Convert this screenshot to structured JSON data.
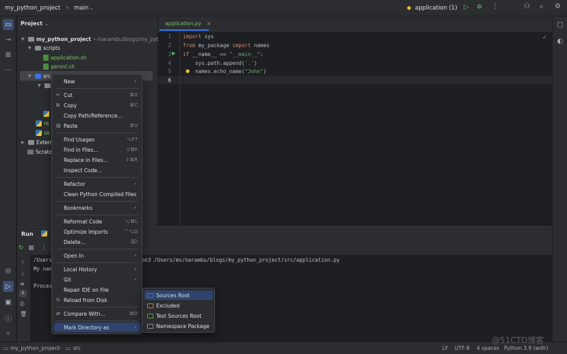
{
  "titlebar": {
    "project": "my_python_project",
    "branch": "main",
    "run_config": "application (1)"
  },
  "project_panel": {
    "title": "Project",
    "tree": [
      {
        "label": "my_python_project",
        "path": "~/narambu/blogs/my_python_"
      },
      {
        "label": "scripts"
      },
      {
        "label": "application.sh"
      },
      {
        "label": "genssl.sh"
      },
      {
        "label": "src"
      },
      {
        "label": "re"
      },
      {
        "label": "se"
      },
      {
        "label": "Extern"
      },
      {
        "label": "Scrato"
      }
    ]
  },
  "editor": {
    "tab": "application.py",
    "line_numbers": [
      "1",
      "2",
      "3",
      "4",
      "5",
      "6"
    ],
    "lines": [
      {
        "k1": "import",
        "rest": " sys"
      },
      {
        "k1": "from",
        "mid": " my_package ",
        "k2": "import",
        "rest": " names"
      },
      {
        "k1": "if",
        "rest": " __name__ == ",
        "s": "\"__main__\"",
        "tail": ":"
      },
      {
        "rest": "    sys.path.append(",
        "s": "'.'",
        "tail": ")"
      },
      {
        "rest": "    names.echo_name(",
        "s": "\"John\"",
        "tail": ")"
      }
    ]
  },
  "run_panel": {
    "title": "Run",
    "console": [
      "/Users",
      "My nam",
      "Proces"
    ],
    "console_tail": "on3 /Users/ms/narambu/blogs/my_python_project/src/application.py"
  },
  "context_menu": {
    "items": [
      {
        "label": "New",
        "shortcut": "",
        "arrow": "›"
      },
      {
        "label": "Cut",
        "shortcut": "⌘X",
        "icon": "✂"
      },
      {
        "label": "Copy",
        "shortcut": "⌘C",
        "icon": "⧉"
      },
      {
        "label": "Copy Path/Reference...",
        "shortcut": ""
      },
      {
        "label": "Paste",
        "shortcut": "⌘V",
        "icon": "▤"
      },
      {
        "label": "Find Usages",
        "shortcut": "⌥F7"
      },
      {
        "label": "Find in Files...",
        "shortcut": "⇧⌘F"
      },
      {
        "label": "Replace in Files...",
        "shortcut": "⇧⌘R"
      },
      {
        "label": "Inspect Code...",
        "shortcut": ""
      },
      {
        "label": "Refactor",
        "arrow": "›"
      },
      {
        "label": "Clean Python Compiled Files"
      },
      {
        "label": "Bookmarks",
        "arrow": "›"
      },
      {
        "label": "Reformat Code",
        "shortcut": "⌥⌘L"
      },
      {
        "label": "Optimize Imports",
        "shortcut": "^⌥O"
      },
      {
        "label": "Delete...",
        "shortcut": "⌦"
      },
      {
        "label": "Open In",
        "arrow": "›"
      },
      {
        "label": "Local History",
        "arrow": "›"
      },
      {
        "label": "Git",
        "arrow": "›"
      },
      {
        "label": "Repair IDE on File"
      },
      {
        "label": "Reload from Disk",
        "icon": "↻"
      },
      {
        "label": "Compare With...",
        "shortcut": "⌘D",
        "icon": "⇄"
      },
      {
        "label": "Mark Directory as",
        "arrow": "›"
      }
    ]
  },
  "submenu": {
    "items": [
      {
        "label": "Sources Root",
        "color": "#3574f0"
      },
      {
        "label": "Excluded",
        "color": "#c97a4a"
      },
      {
        "label": "Test Sources Root",
        "color": "#5f9e52"
      },
      {
        "label": "Namespace Package",
        "color": "#8c8f95"
      }
    ]
  },
  "breadcrumb": {
    "project": "my_python_project",
    "folder": "src"
  },
  "status": {
    "line_sep": "LF",
    "encoding": "UTF-8",
    "indent": "4 spaces",
    "interpreter": "Python 3.9 (wdir)"
  },
  "watermark": "@51CTO博客"
}
